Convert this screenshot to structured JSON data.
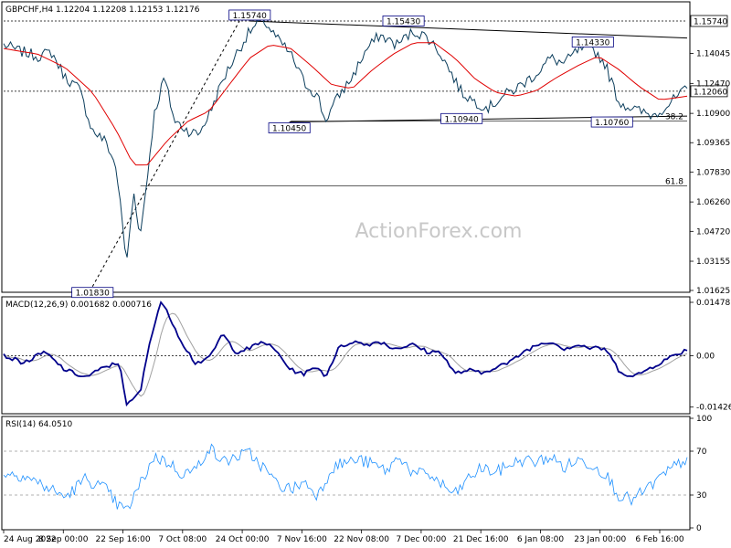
{
  "watermark": "ActionForex.com",
  "chart_data": {
    "type": "line",
    "symbol_header": "GBPCHF,H4  1.12204 1.12208 1.12153 1.12176",
    "x_labels": [
      "24 Aug 2022",
      "8 Sep 00:00",
      "22 Sep 16:00",
      "7 Oct 08:00",
      "24 Oct 00:00",
      "7 Nov 16:00",
      "22 Nov 08:00",
      "7 Dec 00:00",
      "21 Dec 16:00",
      "6 Jan 08:00",
      "23 Jan 00:00",
      "6 Feb 16:00"
    ],
    "price_panel": {
      "ylim": [
        1.01625,
        1.166
      ],
      "yticks": [
        "1.14045",
        "1.12470",
        "1.10900",
        "1.09365",
        "1.07830",
        "1.06260",
        "1.04720",
        "1.03155",
        "1.01625"
      ],
      "current_price": "1.12060",
      "resistance_label": "1.15740",
      "retracement_labels": [
        "38.2",
        "61.8"
      ],
      "retracement_levels": [
        1.1049,
        1.0711
      ],
      "swing_labels": [
        {
          "text": "1.15740",
          "t": 0.36,
          "v": 1.1574
        },
        {
          "text": "1.15430",
          "t": 0.585,
          "v": 1.1543
        },
        {
          "text": "1.14330",
          "t": 0.862,
          "v": 1.1433
        },
        {
          "text": "1.10450",
          "t": 0.418,
          "v": 1.1045
        },
        {
          "text": "1.10940",
          "t": 0.67,
          "v": 1.1094
        },
        {
          "text": "1.10760",
          "t": 0.89,
          "v": 1.1076
        },
        {
          "text": "1.01830",
          "t": 0.13,
          "v": 1.0183
        }
      ],
      "price_anchors": [
        [
          0,
          1.145
        ],
        [
          0.02,
          1.142
        ],
        [
          0.05,
          1.139
        ],
        [
          0.07,
          1.141
        ],
        [
          0.09,
          1.128
        ],
        [
          0.11,
          1.122
        ],
        [
          0.13,
          1.1
        ],
        [
          0.15,
          1.094
        ],
        [
          0.165,
          1.08
        ],
        [
          0.18,
          1.03
        ],
        [
          0.19,
          1.068
        ],
        [
          0.2,
          1.045
        ],
        [
          0.21,
          1.075
        ],
        [
          0.22,
          1.108
        ],
        [
          0.235,
          1.128
        ],
        [
          0.25,
          1.105
        ],
        [
          0.27,
          1.1
        ],
        [
          0.285,
          1.098
        ],
        [
          0.3,
          1.108
        ],
        [
          0.32,
          1.126
        ],
        [
          0.34,
          1.14
        ],
        [
          0.36,
          1.152
        ],
        [
          0.38,
          1.158
        ],
        [
          0.4,
          1.148
        ],
        [
          0.42,
          1.14
        ],
        [
          0.44,
          1.125
        ],
        [
          0.46,
          1.118
        ],
        [
          0.47,
          1.105
        ],
        [
          0.49,
          1.118
        ],
        [
          0.51,
          1.128
        ],
        [
          0.53,
          1.142
        ],
        [
          0.55,
          1.15
        ],
        [
          0.575,
          1.145
        ],
        [
          0.6,
          1.152
        ],
        [
          0.62,
          1.149
        ],
        [
          0.64,
          1.14
        ],
        [
          0.655,
          1.13
        ],
        [
          0.67,
          1.12
        ],
        [
          0.69,
          1.115
        ],
        [
          0.71,
          1.112
        ],
        [
          0.73,
          1.118
        ],
        [
          0.75,
          1.122
        ],
        [
          0.78,
          1.13
        ],
        [
          0.8,
          1.138
        ],
        [
          0.82,
          1.135
        ],
        [
          0.84,
          1.142
        ],
        [
          0.862,
          1.143
        ],
        [
          0.88,
          1.135
        ],
        [
          0.9,
          1.115
        ],
        [
          0.93,
          1.11
        ],
        [
          0.95,
          1.108
        ],
        [
          0.97,
          1.113
        ],
        [
          1.0,
          1.1218
        ]
      ],
      "ma_anchors": [
        [
          0,
          1.143
        ],
        [
          0.05,
          1.14
        ],
        [
          0.09,
          1.133
        ],
        [
          0.13,
          1.12
        ],
        [
          0.165,
          1.1
        ],
        [
          0.19,
          1.082
        ],
        [
          0.21,
          1.082
        ],
        [
          0.24,
          1.095
        ],
        [
          0.27,
          1.105
        ],
        [
          0.3,
          1.11
        ],
        [
          0.33,
          1.124
        ],
        [
          0.36,
          1.138
        ],
        [
          0.39,
          1.145
        ],
        [
          0.42,
          1.143
        ],
        [
          0.45,
          1.134
        ],
        [
          0.48,
          1.124
        ],
        [
          0.51,
          1.122
        ],
        [
          0.54,
          1.132
        ],
        [
          0.57,
          1.14
        ],
        [
          0.6,
          1.146
        ],
        [
          0.63,
          1.146
        ],
        [
          0.66,
          1.138
        ],
        [
          0.69,
          1.127
        ],
        [
          0.72,
          1.12
        ],
        [
          0.75,
          1.118
        ],
        [
          0.78,
          1.121
        ],
        [
          0.81,
          1.128
        ],
        [
          0.84,
          1.134
        ],
        [
          0.87,
          1.139
        ],
        [
          0.9,
          1.132
        ],
        [
          0.93,
          1.123
        ],
        [
          0.96,
          1.116
        ],
        [
          1.0,
          1.118
        ]
      ]
    },
    "macd_panel": {
      "title": "MACD(12,26,9) 0.001682 0.000716",
      "ylim": [
        -0.0156,
        0.0158
      ],
      "yticks": [
        "0.014787",
        "0.00",
        "-0.014263"
      ],
      "macd_anchors": [
        [
          0,
          0.0
        ],
        [
          0.03,
          -0.002
        ],
        [
          0.06,
          0.001
        ],
        [
          0.09,
          -0.004
        ],
        [
          0.12,
          -0.006
        ],
        [
          0.15,
          -0.003
        ],
        [
          0.17,
          -0.002
        ],
        [
          0.18,
          -0.014
        ],
        [
          0.2,
          -0.01
        ],
        [
          0.215,
          0.005
        ],
        [
          0.23,
          0.015
        ],
        [
          0.245,
          0.01
        ],
        [
          0.26,
          0.004
        ],
        [
          0.28,
          -0.002
        ],
        [
          0.3,
          -0.001
        ],
        [
          0.32,
          0.006
        ],
        [
          0.34,
          0.001
        ],
        [
          0.36,
          0.002
        ],
        [
          0.38,
          0.004
        ],
        [
          0.4,
          0.001
        ],
        [
          0.42,
          -0.004
        ],
        [
          0.44,
          -0.005
        ],
        [
          0.46,
          -0.003
        ],
        [
          0.47,
          -0.006
        ],
        [
          0.49,
          0.002
        ],
        [
          0.51,
          0.004
        ],
        [
          0.53,
          0.003
        ],
        [
          0.55,
          0.004
        ],
        [
          0.57,
          0.002
        ],
        [
          0.6,
          0.003
        ],
        [
          0.62,
          0.001
        ],
        [
          0.64,
          0.001
        ],
        [
          0.66,
          -0.005
        ],
        [
          0.68,
          -0.004
        ],
        [
          0.7,
          -0.005
        ],
        [
          0.72,
          -0.003
        ],
        [
          0.74,
          -0.002
        ],
        [
          0.76,
          0.001
        ],
        [
          0.78,
          0.003
        ],
        [
          0.8,
          0.004
        ],
        [
          0.82,
          0.002
        ],
        [
          0.84,
          0.003
        ],
        [
          0.86,
          0.002
        ],
        [
          0.88,
          0.002
        ],
        [
          0.9,
          -0.004
        ],
        [
          0.92,
          -0.006
        ],
        [
          0.94,
          -0.004
        ],
        [
          0.96,
          -0.002
        ],
        [
          0.98,
          0.0
        ],
        [
          1.0,
          0.0017
        ]
      ]
    },
    "rsi_panel": {
      "title": "RSI(14) 64.0510",
      "ylim": [
        0,
        100
      ],
      "yticks": [
        "100",
        "70",
        "30",
        "0"
      ],
      "rsi_anchors": [
        [
          0,
          50
        ],
        [
          0.03,
          48
        ],
        [
          0.06,
          38
        ],
        [
          0.09,
          28
        ],
        [
          0.12,
          45
        ],
        [
          0.15,
          35
        ],
        [
          0.165,
          22
        ],
        [
          0.18,
          15
        ],
        [
          0.2,
          40
        ],
        [
          0.22,
          65
        ],
        [
          0.24,
          60
        ],
        [
          0.26,
          50
        ],
        [
          0.28,
          52
        ],
        [
          0.3,
          74
        ],
        [
          0.32,
          60
        ],
        [
          0.34,
          65
        ],
        [
          0.36,
          68
        ],
        [
          0.38,
          55
        ],
        [
          0.4,
          40
        ],
        [
          0.42,
          35
        ],
        [
          0.44,
          42
        ],
        [
          0.46,
          30
        ],
        [
          0.48,
          55
        ],
        [
          0.5,
          60
        ],
        [
          0.52,
          62
        ],
        [
          0.54,
          58
        ],
        [
          0.56,
          52
        ],
        [
          0.58,
          66
        ],
        [
          0.6,
          48
        ],
        [
          0.62,
          50
        ],
        [
          0.64,
          40
        ],
        [
          0.66,
          30
        ],
        [
          0.68,
          45
        ],
        [
          0.7,
          55
        ],
        [
          0.72,
          50
        ],
        [
          0.74,
          58
        ],
        [
          0.76,
          62
        ],
        [
          0.78,
          60
        ],
        [
          0.8,
          65
        ],
        [
          0.82,
          55
        ],
        [
          0.84,
          62
        ],
        [
          0.86,
          58
        ],
        [
          0.88,
          50
        ],
        [
          0.9,
          30
        ],
        [
          0.92,
          25
        ],
        [
          0.94,
          35
        ],
        [
          0.96,
          45
        ],
        [
          0.98,
          55
        ],
        [
          1.0,
          64
        ]
      ]
    }
  }
}
